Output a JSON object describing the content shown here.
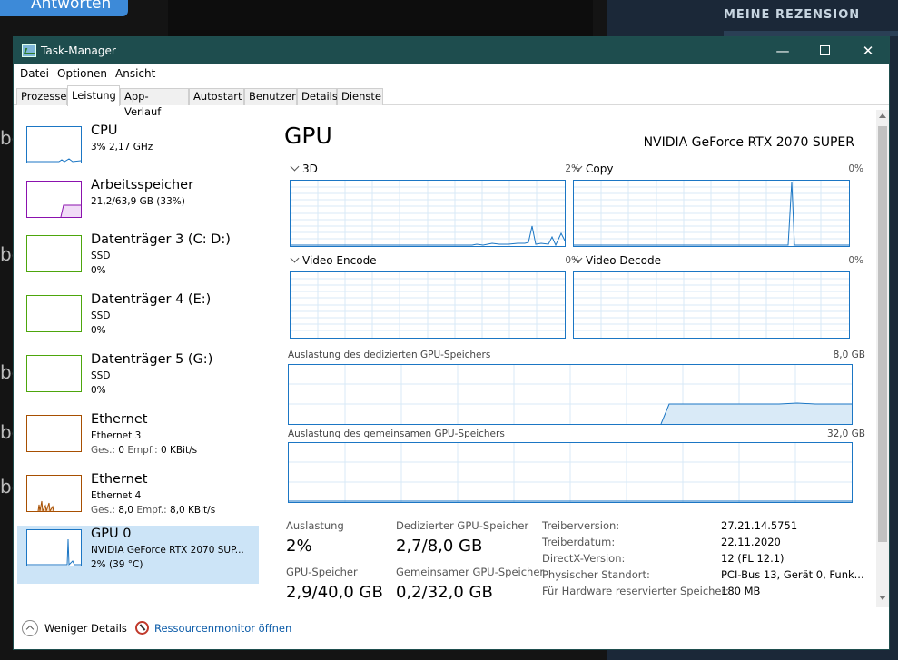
{
  "background": {
    "button_label": "Antworten",
    "review_heading": "MEINE REZENSION",
    "side_letters": [
      "be",
      "be",
      "be",
      "be",
      "be"
    ]
  },
  "window": {
    "title": "Task-Manager",
    "controls": {
      "minimize": "—",
      "maximize": "",
      "close": "✕"
    }
  },
  "menu": [
    "Datei",
    "Optionen",
    "Ansicht"
  ],
  "tabs": [
    {
      "label": "Prozesse",
      "active": false
    },
    {
      "label": "Leistung",
      "active": true
    },
    {
      "label": "App-Verlauf",
      "active": false
    },
    {
      "label": "Autostart",
      "active": false
    },
    {
      "label": "Benutzer",
      "active": false
    },
    {
      "label": "Details",
      "active": false
    },
    {
      "label": "Dienste",
      "active": false
    }
  ],
  "sidebar": [
    {
      "title": "CPU",
      "line2": "3% 2,17 GHz",
      "line3": "",
      "color": "#1b76c4",
      "selected": false
    },
    {
      "title": "Arbeitsspeicher",
      "line2": "21,2/63,9 GB (33%)",
      "line3": "",
      "color": "#8b12ae",
      "selected": false
    },
    {
      "title": "Datenträger 3 (C: D:)",
      "line2": "SSD",
      "line3": "0%",
      "color": "#4da60c",
      "selected": false
    },
    {
      "title": "Datenträger 4 (E:)",
      "line2": "SSD",
      "line3": "0%",
      "color": "#4da60c",
      "selected": false
    },
    {
      "title": "Datenträger 5 (G:)",
      "line2": "SSD",
      "line3": "0%",
      "color": "#4da60c",
      "selected": false
    },
    {
      "title": "Ethernet",
      "line2": "Ethernet 3",
      "line3_parts": [
        "Ges.:",
        " 0 ",
        "Empf.:",
        " 0 KBit/s"
      ],
      "color": "#a74f01",
      "selected": false
    },
    {
      "title": "Ethernet",
      "line2": "Ethernet 4",
      "line3_parts": [
        "Ges.:",
        " 8,0 ",
        "Empf.:",
        " 8,0 KBit/s"
      ],
      "color": "#a74f01",
      "selected": false
    },
    {
      "title": "GPU 0",
      "line2": "NVIDIA GeForce RTX 2070 SUP...",
      "line3": "2% (39 °C)",
      "color": "#1b76c4",
      "selected": true
    }
  ],
  "main": {
    "heading": "GPU",
    "model": "NVIDIA GeForce RTX 2070 SUPER",
    "engines": [
      {
        "label": "3D",
        "pct": "2%"
      },
      {
        "label": "Copy",
        "pct": "0%"
      },
      {
        "label": "Video Encode",
        "pct": "0%"
      },
      {
        "label": "Video Decode",
        "pct": "0%"
      }
    ],
    "dedicated": {
      "label": "Auslastung des dedizierten GPU-Speichers",
      "max": "8,0 GB"
    },
    "shared": {
      "label": "Auslastung des gemeinsamen GPU-Speichers",
      "max": "32,0 GB"
    },
    "stats": [
      {
        "label": "Auslastung",
        "value": "2%"
      },
      {
        "label": "Dedizierter GPU-Speicher",
        "value": "2,7/8,0 GB"
      },
      {
        "label": "GPU-Speicher",
        "value": "2,9/40,0 GB"
      },
      {
        "label": "Gemeinsamer GPU-Speicher",
        "value": "0,2/32,0 GB"
      }
    ],
    "info": [
      {
        "label": "Treiberversion:",
        "value": "27.21.14.5751"
      },
      {
        "label": "Treiberdatum:",
        "value": "22.11.2020"
      },
      {
        "label": "DirectX-Version:",
        "value": "12 (FL 12.1)"
      },
      {
        "label": "Physischer Standort:",
        "value": "PCI-Bus 13, Gerät 0, Funk..."
      },
      {
        "label": "Für Hardware reservierter Speicher:",
        "value": "180 MB"
      }
    ]
  },
  "footer": {
    "fewer_details": "Weniger Details",
    "resource_monitor": "Ressourcenmonitor öffnen"
  },
  "colors": {
    "titlebar": "#1e4d4e",
    "graph_blue": "#1b76c4",
    "selected_bg": "#cce4f7",
    "link": "#0b5ba8"
  }
}
